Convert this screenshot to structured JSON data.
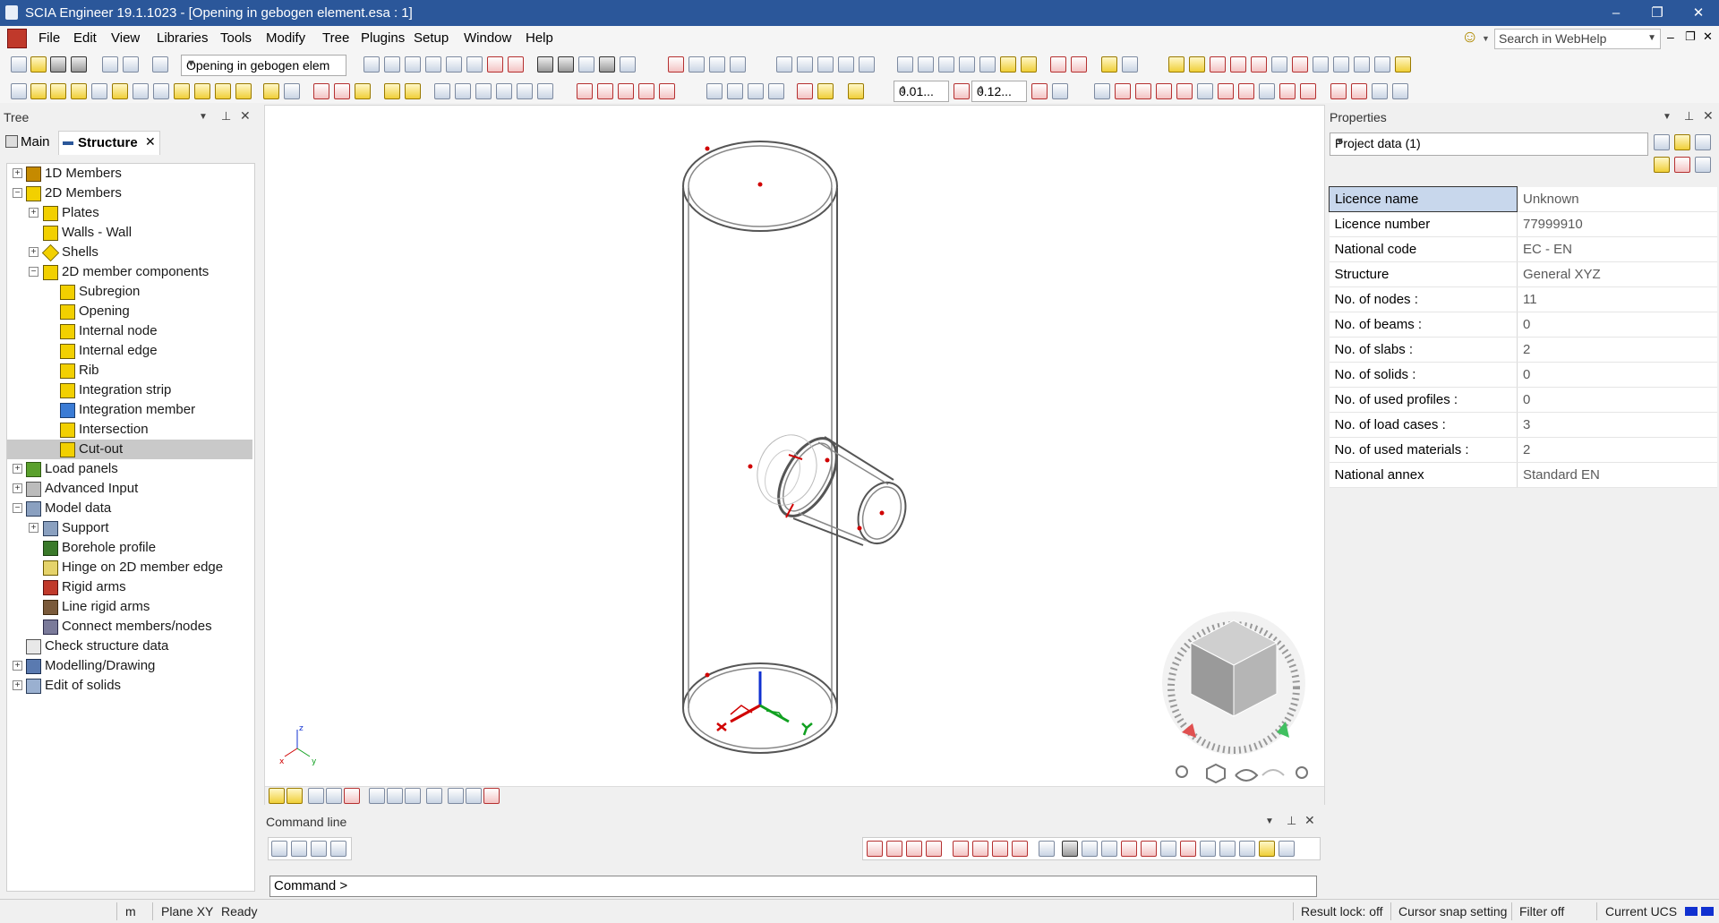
{
  "window": {
    "title": "SCIA Engineer 19.1.1023 - [Opening in gebogen element.esa : 1]",
    "minimize": "–",
    "restore": "❐",
    "close": "✕"
  },
  "menu": {
    "items": [
      "File",
      "Edit",
      "View",
      "Libraries",
      "Tools",
      "Modify",
      "Tree",
      "Plugins",
      "Setup",
      "Window",
      "Help"
    ],
    "search_placeholder": "Search in WebHelp",
    "smiley": "☺"
  },
  "toolbar": {
    "activity_combo": "Opening in gebogen elem",
    "spin1": "0.01...",
    "spin2": "0.12..."
  },
  "tree_panel": {
    "header": "Tree",
    "tabs": [
      {
        "label": "Main"
      },
      {
        "label": "Structure"
      }
    ],
    "items": [
      {
        "label": "1D Members",
        "expander": "+",
        "level": 0
      },
      {
        "label": "2D Members",
        "expander": "−",
        "level": 0
      },
      {
        "label": "Plates",
        "expander": "+",
        "level": 1
      },
      {
        "label": "Walls - Wall",
        "expander": "",
        "level": 1
      },
      {
        "label": "Shells",
        "expander": "+",
        "level": 1
      },
      {
        "label": "2D member components",
        "expander": "−",
        "level": 1
      },
      {
        "label": "Subregion",
        "expander": "",
        "level": 2
      },
      {
        "label": "Opening",
        "expander": "",
        "level": 2
      },
      {
        "label": "Internal node",
        "expander": "",
        "level": 2
      },
      {
        "label": "Internal edge",
        "expander": "",
        "level": 2
      },
      {
        "label": "Rib",
        "expander": "",
        "level": 2
      },
      {
        "label": "Integration strip",
        "expander": "",
        "level": 2
      },
      {
        "label": "Integration member",
        "expander": "",
        "level": 2
      },
      {
        "label": "Intersection",
        "expander": "",
        "level": 2
      },
      {
        "label": "Cut-out",
        "expander": "",
        "level": 2,
        "selected": true
      },
      {
        "label": "Load panels",
        "expander": "+",
        "level": 0
      },
      {
        "label": "Advanced Input",
        "expander": "+",
        "level": 0
      },
      {
        "label": "Model data",
        "expander": "−",
        "level": 0
      },
      {
        "label": "Support",
        "expander": "+",
        "level": 1
      },
      {
        "label": "Borehole profile",
        "expander": "",
        "level": 1
      },
      {
        "label": "Hinge on 2D member edge",
        "expander": "",
        "level": 1
      },
      {
        "label": "Rigid arms",
        "expander": "",
        "level": 1
      },
      {
        "label": "Line rigid arms",
        "expander": "",
        "level": 1
      },
      {
        "label": "Connect members/nodes",
        "expander": "",
        "level": 1
      },
      {
        "label": "Check structure data",
        "expander": "",
        "level": 0
      },
      {
        "label": "Modelling/Drawing",
        "expander": "+",
        "level": 0
      },
      {
        "label": "Edit of solids",
        "expander": "+",
        "level": 0
      }
    ]
  },
  "viewport": {
    "axis_labels": {
      "z": "z",
      "x": "x",
      "y": "y"
    }
  },
  "command_line": {
    "header": "Command line",
    "prompt": "Command >"
  },
  "properties": {
    "header": "Properties",
    "selector": "Project data (1)",
    "rows": [
      {
        "key": "Licence name",
        "value": "Unknown"
      },
      {
        "key": "Licence number",
        "value": "77999910"
      },
      {
        "key": "National code",
        "value": "EC - EN"
      },
      {
        "key": "Structure",
        "value": "General XYZ"
      },
      {
        "key": "No. of nodes :",
        "value": "11"
      },
      {
        "key": "No. of beams :",
        "value": "0"
      },
      {
        "key": "No. of slabs :",
        "value": "2"
      },
      {
        "key": "No. of solids :",
        "value": "0"
      },
      {
        "key": "No. of used profiles :",
        "value": "0"
      },
      {
        "key": "No. of load cases :",
        "value": "3"
      },
      {
        "key": "No. of used materials :",
        "value": "2"
      },
      {
        "key": "National annex",
        "value": "Standard EN"
      }
    ]
  },
  "status_bar": {
    "unit": "m",
    "plane": "Plane XY",
    "state": "Ready",
    "result_lock": "Result lock: off",
    "cursor_snap": "Cursor snap setting",
    "filter": "Filter off",
    "ucs": "Current UCS"
  },
  "colors": {
    "titlebar": "#2b579a",
    "selection": "#c9c9c9",
    "node_dot": "#d00000"
  }
}
